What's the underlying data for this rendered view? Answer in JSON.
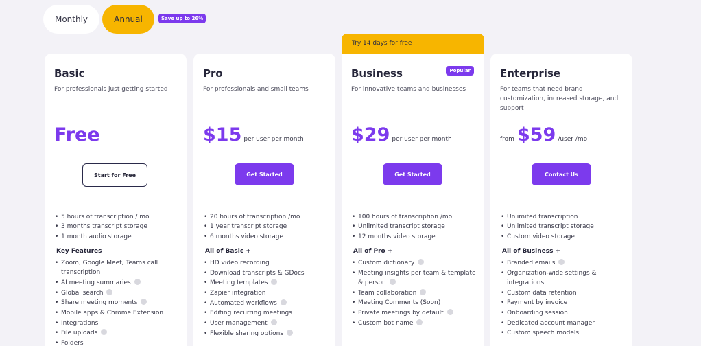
{
  "toggle": {
    "monthly": "Monthly",
    "annual": "Annual",
    "save_badge": "Save up to 26%"
  },
  "trial_banner": "Try 14 days for free",
  "plans": [
    {
      "name": "Basic",
      "description": "For professionals just getting started",
      "price_prefix": "",
      "price": "Free",
      "price_suffix": "",
      "cta": "Start for Free",
      "basics": [
        "5 hours of transcription / mo",
        "3 months transcript storage",
        "1 month audio storage"
      ],
      "features_title": "Key Features",
      "features": [
        {
          "text": "Zoom, Google Meet, Teams call transcription",
          "info": false
        },
        {
          "text": "AI meeting summaries",
          "info": true
        },
        {
          "text": "Global search",
          "info": true
        },
        {
          "text": "Share meeting moments",
          "info": true
        },
        {
          "text": "Mobile apps & Chrome Extension",
          "info": false
        },
        {
          "text": "Integrations",
          "info": false
        },
        {
          "text": "File uploads",
          "info": true
        },
        {
          "text": "Folders",
          "info": false
        }
      ]
    },
    {
      "name": "Pro",
      "description": "For professionals and small teams",
      "price_prefix": "",
      "price": "$15",
      "price_suffix": "per user per month",
      "cta": "Get Started",
      "basics": [
        "20 hours of transcription /mo",
        "1 year transcript storage",
        "6 months video storage"
      ],
      "features_title": "All of Basic +",
      "features": [
        {
          "text": "HD video recording",
          "info": false
        },
        {
          "text": "Download transcripts & GDocs",
          "info": false
        },
        {
          "text": "Meeting templates",
          "info": true
        },
        {
          "text": "Zapier integration",
          "info": false
        },
        {
          "text": "Automated workflows",
          "info": true
        },
        {
          "text": "Editing recurring meetings",
          "info": false
        },
        {
          "text": "User management",
          "info": true
        },
        {
          "text": "Flexible sharing options",
          "info": true
        }
      ]
    },
    {
      "name": "Business",
      "badge": "Popular",
      "description": "For innovative teams and businesses",
      "price_prefix": "",
      "price": "$29",
      "price_suffix": "per user per month",
      "cta": "Get Started",
      "basics": [
        "100 hours of transcription /mo",
        "Unlimited transcript storage",
        "12 months video storage"
      ],
      "features_title": "All of Pro +",
      "features": [
        {
          "text": "Custom dictionary",
          "info": true
        },
        {
          "text": "Meeting insights per team & template & person",
          "info": true
        },
        {
          "text": "Team collaboration",
          "info": true
        },
        {
          "text": "Meeting Comments (Soon)",
          "info": false
        },
        {
          "text": "Private meetings by default",
          "info": true
        },
        {
          "text": "Custom bot name",
          "info": true
        }
      ]
    },
    {
      "name": "Enterprise",
      "description": "For teams that need brand customization, increased storage, and support",
      "price_prefix": "from",
      "price": "$59",
      "price_suffix": "/user /mo",
      "cta": "Contact Us",
      "basics": [
        "Unlimited transcription",
        "Unlimited transcript storage",
        "Custom video storage"
      ],
      "features_title": "All of Business +",
      "features": [
        {
          "text": "Branded emails",
          "info": true
        },
        {
          "text": "Organization-wide settings & integrations",
          "info": false
        },
        {
          "text": "Custom data retention",
          "info": false
        },
        {
          "text": "Payment by invoice",
          "info": false
        },
        {
          "text": "Onboarding session",
          "info": false
        },
        {
          "text": "Dedicated account manager",
          "info": false
        },
        {
          "text": "Custom speech models",
          "info": false
        }
      ]
    }
  ],
  "colors": {
    "accent": "#7c3aed",
    "highlight": "#f7b500",
    "background": "#f3f2f7"
  }
}
